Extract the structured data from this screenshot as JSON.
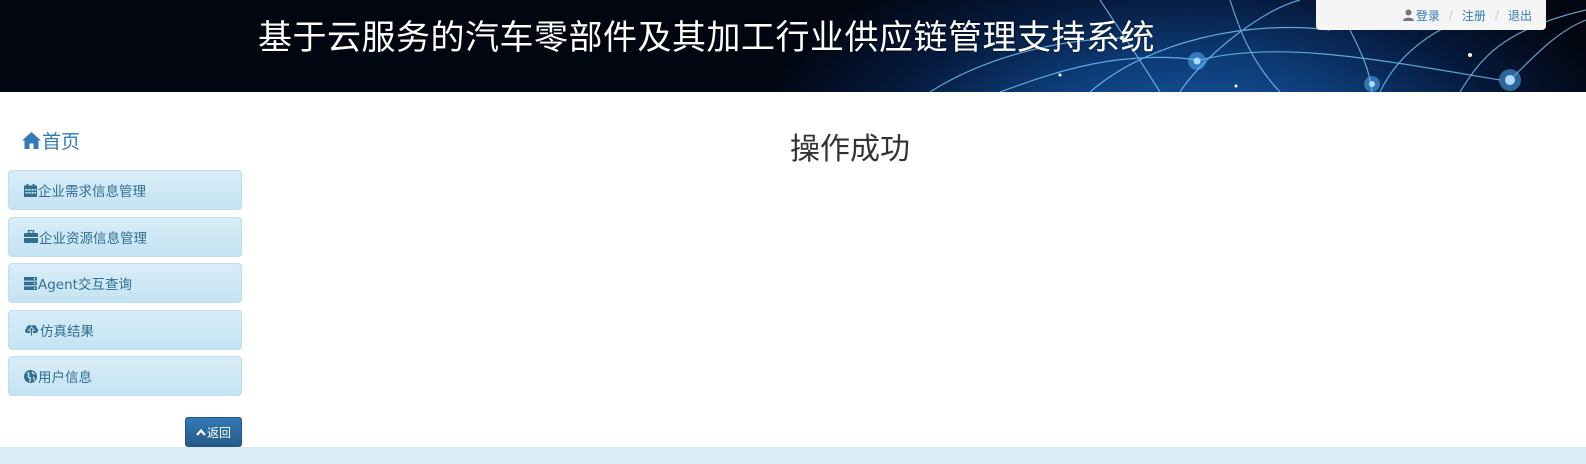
{
  "banner": {
    "title": "基于云服务的汽车零部件及其加工行业供应链管理支持系统"
  },
  "user_nav": {
    "login_label": "登录",
    "register_label": "注册",
    "logout_label": "退出",
    "separator": "/",
    "icon": "user-icon"
  },
  "sidebar": {
    "home": {
      "label": "首页",
      "icon": "home-icon"
    },
    "items": [
      {
        "label": "企业需求信息管理",
        "icon": "calendar-icon"
      },
      {
        "label": "企业资源信息管理",
        "icon": "briefcase-icon"
      },
      {
        "label": "Agent交互查询",
        "icon": "server-icon"
      },
      {
        "label": "仿真结果",
        "icon": "cloud-upload-icon"
      },
      {
        "label": "用户信息",
        "icon": "globe-icon"
      }
    ],
    "back_label": "返回",
    "back_icon": "chevron-up-icon"
  },
  "main": {
    "title": "操作成功"
  },
  "colors": {
    "link": "#337ab7",
    "menu_bg": "#d9edf7",
    "menu_text": "#31708f",
    "button_bg": "#337ab7"
  }
}
